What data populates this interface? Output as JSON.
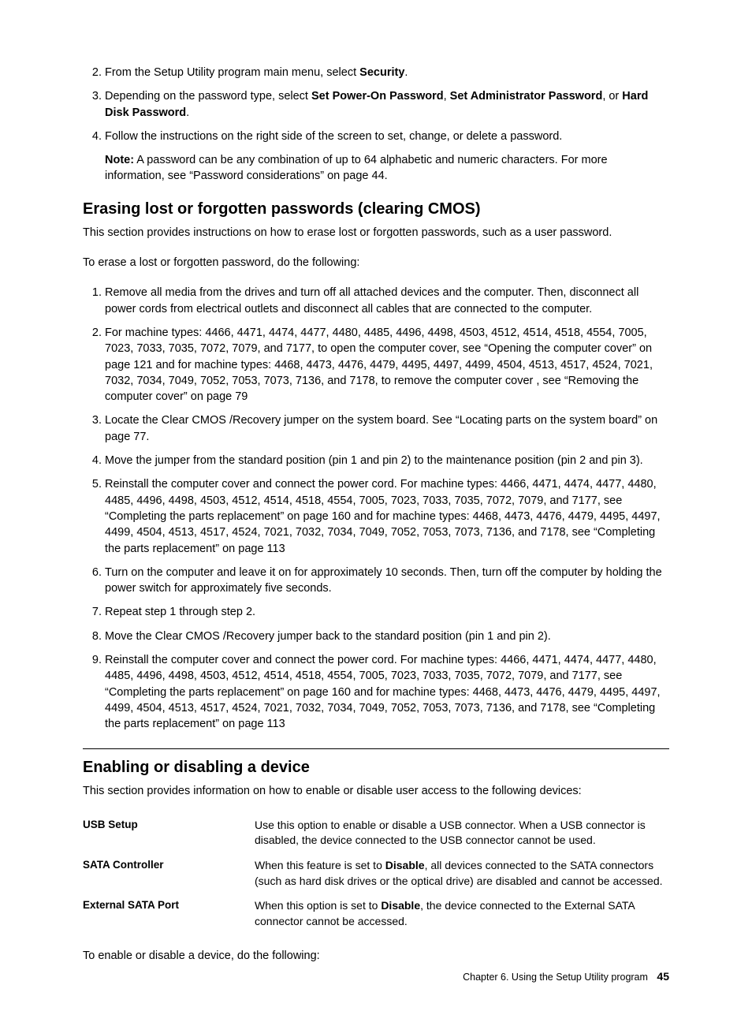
{
  "steps_top": {
    "start": 2,
    "items": [
      {
        "pre": "From the Setup Utility program main menu, select ",
        "bold1": "Security",
        "post1": "."
      },
      {
        "pre": "Depending on the password type, select ",
        "bold1": "Set Power-On Password",
        "mid1": ", ",
        "bold2": "Set Administrator Password",
        "mid2": ", or ",
        "bold3": "Hard Disk Password",
        "post1": "."
      },
      {
        "pre": "Follow the instructions on the right side of the screen to set, change, or delete a password."
      }
    ],
    "note_label": "Note:",
    "note_text": " A password can be any combination of up to 64 alphabetic and numeric characters. For more information, see “Password considerations” on page 44."
  },
  "section1": {
    "heading": "Erasing lost or forgotten passwords (clearing CMOS)",
    "intro1": "This section provides instructions on how to erase lost or forgotten passwords, such as a user password.",
    "intro2": "To erase a lost or forgotten password, do the following:",
    "steps": [
      "Remove all media from the drives and turn off all attached devices and the computer. Then, disconnect all power cords from electrical outlets and disconnect all cables that are connected to the computer.",
      "For machine types: 4466, 4471, 4474, 4477, 4480, 4485, 4496, 4498, 4503, 4512, 4514, 4518, 4554, 7005, 7023, 7033, 7035, 7072, 7079, and 7177, to open the computer cover, see “Opening the computer cover” on page 121 and for machine types: 4468, 4473, 4476, 4479, 4495, 4497, 4499, 4504, 4513, 4517, 4524, 7021, 7032, 7034, 7049, 7052, 7053, 7073, 7136, and 7178, to remove the computer cover , see “Removing the computer cover” on page 79",
      "Locate the Clear CMOS /Recovery jumper on the system board. See “Locating parts on the system board” on page 77.",
      "Move the jumper from the standard position (pin 1 and pin 2) to the maintenance position (pin 2 and pin 3).",
      "Reinstall the computer cover and connect the power cord. For machine types: 4466, 4471, 4474, 4477, 4480, 4485, 4496, 4498, 4503, 4512, 4514, 4518, 4554, 7005, 7023, 7033, 7035, 7072, 7079, and 7177, see “Completing the parts replacement” on page 160 and for machine types: 4468, 4473, 4476, 4479, 4495, 4497, 4499, 4504, 4513, 4517, 4524, 7021, 7032, 7034, 7049, 7052, 7053, 7073, 7136, and 7178, see “Completing the parts replacement” on page 113",
      "Turn on the computer and leave it on for approximately 10 seconds. Then, turn off the computer by holding the power switch for approximately five seconds.",
      "Repeat step 1 through step 2.",
      "Move the Clear CMOS /Recovery jumper back to the standard position (pin 1 and pin 2).",
      "Reinstall the computer cover and connect the power cord. For machine types: 4466, 4471, 4474, 4477, 4480, 4485, 4496, 4498, 4503, 4512, 4514, 4518, 4554, 7005, 7023, 7033, 7035, 7072, 7079, and 7177, see “Completing the parts replacement” on page 160 and for machine types: 4468, 4473, 4476, 4479, 4495, 4497, 4499, 4504, 4513, 4517, 4524, 7021, 7032, 7034, 7049, 7052, 7053, 7073, 7136, and 7178, see “Completing the parts replacement” on page 113"
    ]
  },
  "section2": {
    "heading": "Enabling or disabling a device",
    "intro": "This section provides information on how to enable or disable user access to the following devices:",
    "devices": [
      {
        "label": "USB Setup",
        "pre": "Use this option to enable or disable a USB connector. When a USB connector is disabled, the device connected to the USB connector cannot be used."
      },
      {
        "label": "SATA Controller",
        "pre": "When this feature is set to ",
        "bold": "Disable",
        "post": ", all devices connected to the SATA connectors (such as hard disk drives or the optical drive) are disabled and cannot be accessed."
      },
      {
        "label": "External SATA Port",
        "pre": "When this option is set to ",
        "bold": "Disable",
        "post": ", the device connected to the External SATA connector cannot be accessed."
      }
    ],
    "outro": "To enable or disable a device, do the following:"
  },
  "footer": {
    "chapter": "Chapter 6. Using the Setup Utility program",
    "page": "45"
  }
}
